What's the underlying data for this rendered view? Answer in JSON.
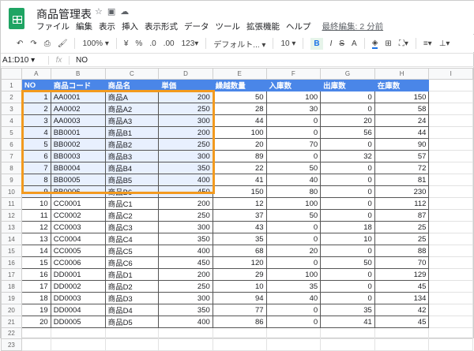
{
  "app": {
    "title": "商品管理表",
    "title_icons": [
      "star-icon",
      "folder-icon",
      "cloud-icon"
    ],
    "menu": [
      "ファイル",
      "編集",
      "表示",
      "挿入",
      "表示形式",
      "データ",
      "ツール",
      "拡張機能",
      "ヘルプ"
    ],
    "last_edit": "最終編集: 2 分前"
  },
  "toolbar": {
    "zoom": "100% ▾",
    "currency": "¥",
    "percent": "%",
    "dec_less": ".0",
    "dec_more": ".00",
    "format": "123▾",
    "font": "デフォルト... ▾",
    "size": "10 ▾",
    "bold": "B",
    "italic": "I",
    "strike": "S",
    "color": "A"
  },
  "formula": {
    "ref": "A1:D10 ▾",
    "fx": "fx",
    "value": "NO"
  },
  "colors": {
    "header": "#4a86e8",
    "selection": "#f29a1f",
    "selfill": "#e8f0fe"
  },
  "columns": [
    "A",
    "B",
    "C",
    "D",
    "E",
    "F",
    "G",
    "H",
    "I"
  ],
  "headers": [
    "NO",
    "商品コード",
    "商品名",
    "単価",
    "繰越数量",
    "入庫数",
    "出庫数",
    "在庫数"
  ],
  "rows": [
    [
      1,
      "AA0001",
      "商品A",
      200,
      50,
      100,
      0,
      150
    ],
    [
      2,
      "AA0002",
      "商品A2",
      250,
      28,
      30,
      0,
      58
    ],
    [
      3,
      "AA0003",
      "商品A3",
      300,
      44,
      0,
      20,
      24
    ],
    [
      4,
      "BB0001",
      "商品B1",
      200,
      100,
      0,
      56,
      44
    ],
    [
      5,
      "BB0002",
      "商品B2",
      250,
      20,
      70,
      0,
      90
    ],
    [
      6,
      "BB0003",
      "商品B3",
      300,
      89,
      0,
      32,
      57
    ],
    [
      7,
      "BB0004",
      "商品B4",
      350,
      22,
      50,
      0,
      72
    ],
    [
      8,
      "BB0005",
      "商品B5",
      400,
      41,
      40,
      0,
      81
    ],
    [
      9,
      "BB0006",
      "商品B6",
      450,
      150,
      80,
      0,
      230
    ],
    [
      10,
      "CC0001",
      "商品C1",
      200,
      12,
      100,
      0,
      112
    ],
    [
      11,
      "CC0002",
      "商品C2",
      250,
      37,
      50,
      0,
      87
    ],
    [
      12,
      "CC0003",
      "商品C3",
      300,
      43,
      0,
      18,
      25
    ],
    [
      13,
      "CC0004",
      "商品C4",
      350,
      35,
      0,
      10,
      25
    ],
    [
      14,
      "CC0005",
      "商品C5",
      400,
      68,
      20,
      0,
      88
    ],
    [
      15,
      "CC0006",
      "商品C6",
      450,
      120,
      0,
      50,
      70
    ],
    [
      16,
      "DD0001",
      "商品D1",
      200,
      29,
      100,
      0,
      129
    ],
    [
      17,
      "DD0002",
      "商品D2",
      250,
      10,
      35,
      0,
      45
    ],
    [
      18,
      "DD0003",
      "商品D3",
      300,
      94,
      40,
      0,
      134
    ],
    [
      19,
      "DD0004",
      "商品D4",
      350,
      77,
      0,
      35,
      42
    ],
    [
      20,
      "DD0005",
      "商品D5",
      400,
      86,
      0,
      41,
      45
    ]
  ],
  "empty_rows": [
    22,
    23
  ]
}
